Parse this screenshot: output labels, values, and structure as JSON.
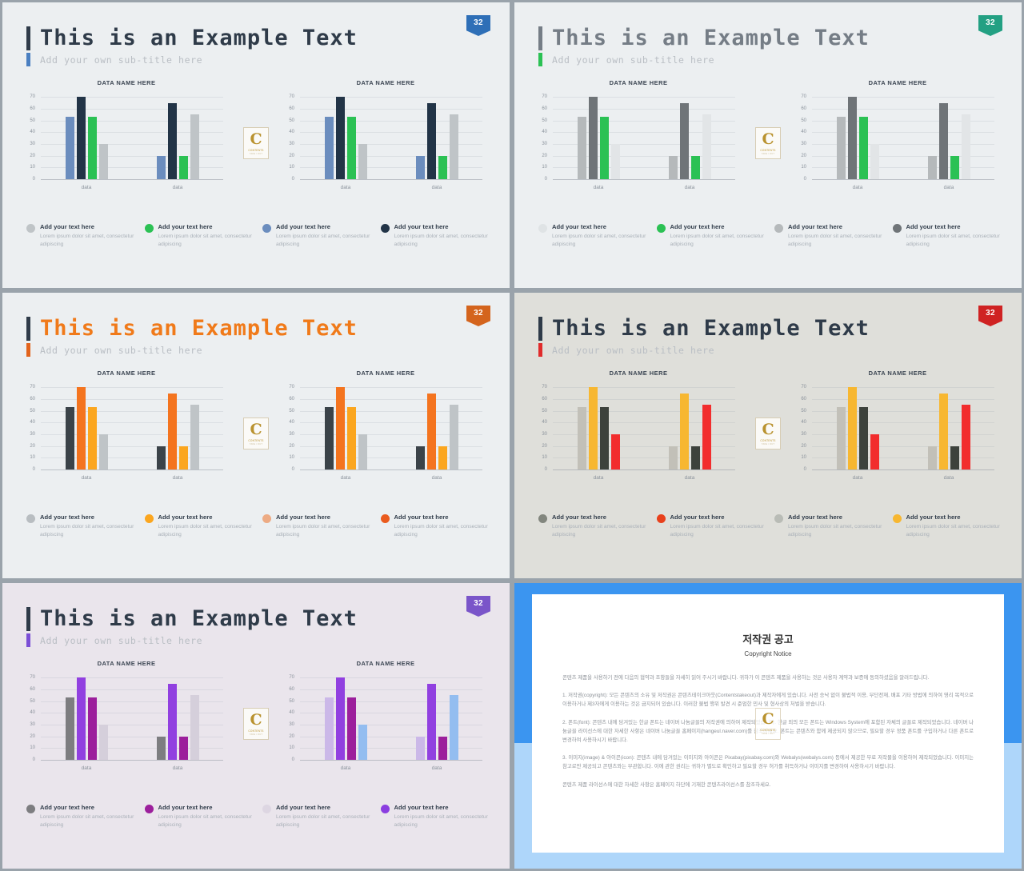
{
  "common": {
    "title": "This is an Example Text",
    "subtitle": "Add your own sub-title here",
    "badge": "32",
    "chart_title": "DATA NAME HERE",
    "xlabel": "data",
    "legend_title": "Add your text here",
    "legend_desc": "Lorem ipsum dolor sit amet, consectetur adipiscing",
    "logo_letter": "C",
    "logo_sub1": "CONTENTS",
    "logo_sub2": "TAKE / OUT"
  },
  "slides": [
    {
      "id": "slide-blue",
      "background": "#eceff1",
      "title_color": "#2f3b49",
      "accent": "#4a7fc1",
      "badge_color": "#2e6fb7",
      "chart_data": {
        "type": "bar",
        "title": "DATA NAME HERE",
        "categories": [
          "data",
          "data"
        ],
        "xlabel": "",
        "ylabel": "",
        "ylim": [
          0,
          75
        ],
        "yticks": [
          0,
          10,
          20,
          30,
          40,
          50,
          60,
          70
        ],
        "grid": true,
        "legend_position": "bottom",
        "series": [
          {
            "name": "Add your text here",
            "color": "#6b8dbe",
            "values": [
              53,
              20
            ]
          },
          {
            "name": "Add your text here",
            "color": "#223447",
            "values": [
              70,
              65
            ]
          },
          {
            "name": "Add your text here",
            "color": "#2bc154",
            "values": [
              53,
              20
            ]
          },
          {
            "name": "Add your text here",
            "color": "#bfc4c7",
            "values": [
              30,
              55
            ]
          }
        ]
      },
      "legend": [
        {
          "color": "#bfc4c7",
          "title": "Add your text here",
          "desc": "Lorem ipsum dolor sit amet, consectetur adipiscing"
        },
        {
          "color": "#2bc154",
          "title": "Add your text here",
          "desc": "Lorem ipsum dolor sit amet, consectetur adipiscing"
        },
        {
          "color": "#6b8dbe",
          "title": "Add your text here",
          "desc": "Lorem ipsum dolor sit amet, consectetur adipiscing"
        },
        {
          "color": "#223447",
          "title": "Add your text here",
          "desc": "Lorem ipsum dolor sit amet, consectetur adipiscing"
        }
      ]
    },
    {
      "id": "slide-green",
      "background": "#eceff1",
      "title_color": "#757d86",
      "accent": "#2bc154",
      "badge_color": "#23a083",
      "chart_data": {
        "type": "bar",
        "title": "DATA NAME HERE",
        "categories": [
          "data",
          "data"
        ],
        "ylim": [
          0,
          75
        ],
        "yticks": [
          0,
          10,
          20,
          30,
          40,
          50,
          60,
          70
        ],
        "grid": true,
        "legend_position": "bottom",
        "series": [
          {
            "name": "Add your text here",
            "color": "#b5b9bb",
            "values": [
              53,
              20
            ]
          },
          {
            "name": "Add your text here",
            "color": "#6f7478",
            "values": [
              70,
              65
            ]
          },
          {
            "name": "Add your text here",
            "color": "#2bc154",
            "values": [
              53,
              20
            ]
          },
          {
            "name": "Add your text here",
            "color": "#e2e5e7",
            "values": [
              30,
              55
            ]
          }
        ]
      },
      "legend": [
        {
          "color": "#dfe3e5",
          "title": "Add your text here",
          "desc": "Lorem ipsum dolor sit amet, consectetur adipiscing"
        },
        {
          "color": "#2bc154",
          "title": "Add your text here",
          "desc": "Lorem ipsum dolor sit amet, consectetur adipiscing"
        },
        {
          "color": "#b5b9bb",
          "title": "Add your text here",
          "desc": "Lorem ipsum dolor sit amet, consectetur adipiscing"
        },
        {
          "color": "#6f7478",
          "title": "Add your text here",
          "desc": "Lorem ipsum dolor sit amet, consectetur adipiscing"
        }
      ]
    },
    {
      "id": "slide-orange",
      "background": "#eceff1",
      "title_color": "#f07a1a",
      "accent": "#e2631c",
      "badge_color": "#d4641d",
      "chart_data": {
        "type": "bar",
        "title": "DATA NAME HERE",
        "categories": [
          "data",
          "data"
        ],
        "ylim": [
          0,
          75
        ],
        "yticks": [
          0,
          10,
          20,
          30,
          40,
          50,
          60,
          70
        ],
        "grid": true,
        "legend_position": "bottom",
        "series": [
          {
            "name": "Add your text here",
            "color": "#3b4349",
            "values": [
              53,
              20
            ]
          },
          {
            "name": "Add your text here",
            "color": "#f4741f",
            "values": [
              70,
              65
            ]
          },
          {
            "name": "Add your text here",
            "color": "#fba61f",
            "values": [
              53,
              20
            ]
          },
          {
            "name": "Add your text here",
            "color": "#bfc4c7",
            "values": [
              30,
              55
            ]
          }
        ]
      },
      "legend": [
        {
          "color": "#b8bdc1",
          "title": "Add your text here",
          "desc": "Lorem ipsum dolor sit amet, consectetur adipiscing"
        },
        {
          "color": "#fba61f",
          "title": "Add your text here",
          "desc": "Lorem ipsum dolor sit amet, consectetur adipiscing"
        },
        {
          "color": "#edab84",
          "title": "Add your text here",
          "desc": "Lorem ipsum dolor sit amet, consectetur adipiscing"
        },
        {
          "color": "#ea5b1e",
          "title": "Add your text here",
          "desc": "Lorem ipsum dolor sit amet, consectetur adipiscing"
        }
      ]
    },
    {
      "id": "slide-red",
      "background": "#dfdfda",
      "title_color": "#2f3b49",
      "accent": "#e02b2b",
      "badge_color": "#cf2222",
      "chart_data": {
        "type": "bar",
        "title": "DATA NAME HERE",
        "categories": [
          "data",
          "data"
        ],
        "ylim": [
          0,
          75
        ],
        "yticks": [
          0,
          10,
          20,
          30,
          40,
          50,
          60,
          70
        ],
        "grid": true,
        "legend_position": "bottom",
        "series": [
          {
            "name": "Add your text here",
            "color": "#c2c0b8",
            "values": [
              53,
              20
            ]
          },
          {
            "name": "Add your text here",
            "color": "#f7b731",
            "values": [
              70,
              65
            ]
          },
          {
            "name": "Add your text here",
            "color": "#3d423c",
            "values": [
              53,
              20
            ]
          },
          {
            "name": "Add your text here",
            "color": "#f22d2d",
            "values": [
              30,
              55
            ]
          }
        ]
      },
      "legend": [
        {
          "color": "#82867e",
          "title": "Add your text here",
          "desc": "Lorem ipsum dolor sit amet, consectetur adipiscing"
        },
        {
          "color": "#e8401b",
          "title": "Add your text here",
          "desc": "Lorem ipsum dolor sit amet, consectetur adipiscing"
        },
        {
          "color": "#b9bcb6",
          "title": "Add your text here",
          "desc": "Lorem ipsum dolor sit amet, consectetur adipiscing"
        },
        {
          "color": "#f7b731",
          "title": "Add your text here",
          "desc": "Lorem ipsum dolor sit amet, consectetur adipiscing"
        }
      ]
    },
    {
      "id": "slide-purple",
      "background": "#eae5ec",
      "title_color": "#2f3b49",
      "accent": "#7b4fd6",
      "badge_color": "#7a55c9",
      "chart_data": {
        "type": "bar",
        "title": "DATA NAME HERE",
        "categories": [
          "data",
          "data"
        ],
        "ylim": [
          0,
          75
        ],
        "yticks": [
          0,
          10,
          20,
          30,
          40,
          50,
          60,
          70
        ],
        "grid": true,
        "legend_position": "bottom",
        "series": [
          {
            "name": "Add your text here",
            "color": "#7d7d80",
            "values": [
              53,
              20
            ]
          },
          {
            "name": "Add your text here",
            "color": "#9140e0",
            "values": [
              70,
              65
            ]
          },
          {
            "name": "Add your text here",
            "color": "#9c1f9c",
            "values": [
              53,
              20
            ]
          },
          {
            "name": "Add your text here",
            "color": "#d5cfdb",
            "values": [
              30,
              55
            ]
          }
        ]
      },
      "legend": [
        {
          "color": "#7d7d80",
          "title": "Add your text here",
          "desc": "Lorem ipsum dolor sit amet, consectetur adipiscing"
        },
        {
          "color": "#9c1f9c",
          "title": "Add your text here",
          "desc": "Lorem ipsum dolor sit amet, consectetur adipiscing"
        },
        {
          "color": "#ddd6e2",
          "title": "Add your text here",
          "desc": "Lorem ipsum dolor sit amet, consectetur adipiscing"
        },
        {
          "color": "#8b3ee0",
          "title": "Add your text here",
          "desc": "Lorem ipsum dolor sit amet, consectetur adipiscing"
        }
      ]
    }
  ],
  "slide2_variant": {
    "series": [
      {
        "color": "#b5b9bb",
        "values": [
          53,
          20
        ]
      },
      {
        "color": "#6f7478",
        "values": [
          70,
          65
        ]
      },
      {
        "color": "#2bc154",
        "values": [
          53,
          20
        ]
      },
      {
        "color": "#e2e5e7",
        "values": [
          30,
          55
        ]
      }
    ]
  },
  "slide5_variant": {
    "series": [
      {
        "color": "#cbb8e8",
        "values": [
          53,
          20
        ]
      },
      {
        "color": "#9140e0",
        "values": [
          70,
          65
        ]
      },
      {
        "color": "#9c1f9c",
        "values": [
          53,
          20
        ]
      },
      {
        "color": "#93bdf0",
        "values": [
          30,
          55
        ]
      }
    ]
  },
  "copyright": {
    "title": "저작권 공고",
    "subtitle": "Copyright Notice",
    "paragraphs": [
      "콘텐츠 제품을 사용하기 전에 다음의 협약과 조항들을 자세히 읽어 주시기 바랍니다. 귀하가 이 콘텐츠 제품을 사용하는 것은 사용자 계약과 보증에 동의하셨음을 알려드립니다.",
      "1. 저작권(copyright): 모든 콘텐츠의 소유 및 저작권은 콘텐츠테이크아웃(Contentstakeout)과 제작자에게 있습니다. 사전 승낙 없이 불법적 이용, 무단전재, 배포 기타 방법에 의하여 영리 목적으로 이용하거나 제3자에게 이용하는 것은 금지되어 있습니다. 이러한 불법 행위 발견 시 준엄한 민사 및 형사상의 처벌을 받습니다.",
      "2. 폰트(font): 콘텐츠 내에 담겨있는 한글 폰트는 네이버 나눔글꼴의 저작권에 의하여 제작되었습니다. 한글 외의 모든 폰트는 Windows System에 포함된 자체의 글꼴로 제작되었습니다. 네이버 나눔글꼴 라이선스에 대한 자세한 사항은 네이버 나눔글꼴 홈페이지(hangeul.naver.com)를 참조하세요. 폰트는 콘텐츠와 함께 제공되지 않으므로, 필요할 경우 정품 폰트를 구입하거나 다른 폰트로 변경하여 사용하시기 바랍니다.",
      "3. 이미지(image) & 아이콘(icon): 콘텐츠 내에 담겨있는 이미지와 아이콘은 Pixabay(pixabay.com)와 Webalys(webalys.com) 등에서 제공한 무료 저작물을 이용하여 제작되었습니다. 이미지는 참고로만 제공되고 콘텐츠와는 무관합니다. 이에 관한 권리는 귀하가 별도로 확인하고 필요할 경우 허가를 취득하거나 이미지를 변경하여 사용하시기 바랍니다.",
      "콘텐츠 제품 라이선스에 대한 자세한 사항은 홈페이지 하단에 기재한 콘텐츠라이선스를 참조하세요."
    ]
  }
}
